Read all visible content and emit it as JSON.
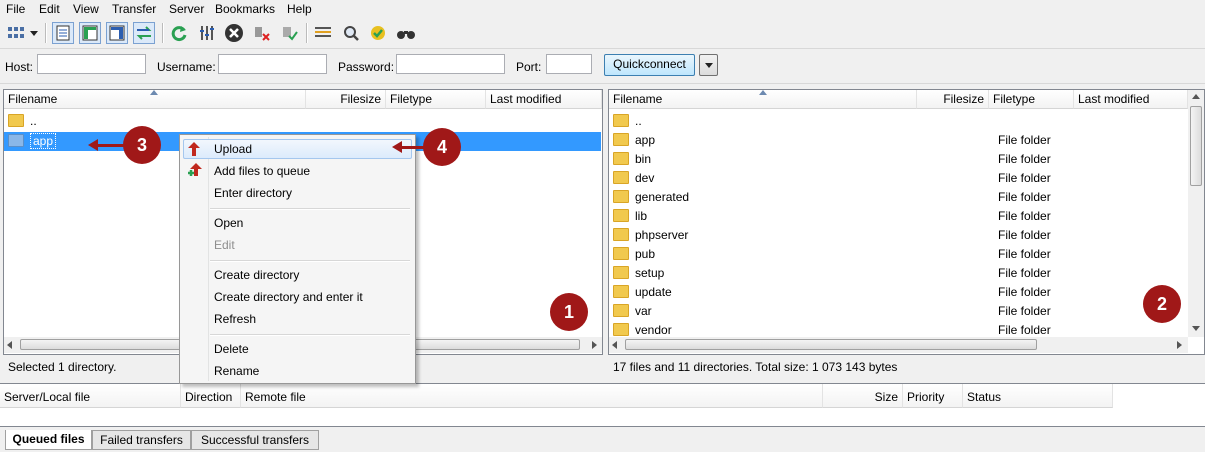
{
  "menubar": [
    "File",
    "Edit",
    "View",
    "Transfer",
    "Server",
    "Bookmarks",
    "Help"
  ],
  "toolbar": {
    "icons": [
      "site-manager-icon",
      "dropdown-arrow-icon",
      "toggle-log-icon",
      "toggle-local-tree-icon",
      "toggle-remote-tree-icon",
      "toggle-queue-icon",
      "refresh-icon",
      "process-queue-icon",
      "cancel-icon",
      "disconnect-icon",
      "reconnect-icon",
      "directory-filter-icon",
      "search-icon",
      "compare-icon",
      "find-files-icon"
    ]
  },
  "quickconnect": {
    "host_label": "Host:",
    "host_value": "",
    "username_label": "Username:",
    "username_value": "",
    "password_label": "Password:",
    "password_value": "",
    "port_label": "Port:",
    "port_value": "",
    "button": "Quickconnect"
  },
  "local": {
    "columns": [
      "Filename",
      "Filesize",
      "Filetype",
      "Last modified"
    ],
    "rows": [
      {
        "name": ".."
      },
      {
        "name": "app"
      }
    ],
    "status": "Selected 1 directory."
  },
  "remote": {
    "columns": [
      "Filename",
      "Filesize",
      "Filetype",
      "Last modified"
    ],
    "rows": [
      {
        "name": "..",
        "type": ""
      },
      {
        "name": "app",
        "type": "File folder"
      },
      {
        "name": "bin",
        "type": "File folder"
      },
      {
        "name": "dev",
        "type": "File folder"
      },
      {
        "name": "generated",
        "type": "File folder"
      },
      {
        "name": "lib",
        "type": "File folder"
      },
      {
        "name": "phpserver",
        "type": "File folder"
      },
      {
        "name": "pub",
        "type": "File folder"
      },
      {
        "name": "setup",
        "type": "File folder"
      },
      {
        "name": "update",
        "type": "File folder"
      },
      {
        "name": "var",
        "type": "File folder"
      },
      {
        "name": "vendor",
        "type": "File folder"
      }
    ],
    "status": "17 files and 11 directories. Total size: 1 073 143 bytes"
  },
  "context_menu": {
    "items": [
      "Upload",
      "Add files to queue",
      "Enter directory",
      "Open",
      "Edit",
      "Create directory",
      "Create directory and enter it",
      "Refresh",
      "Delete",
      "Rename"
    ],
    "disabled": [
      "Edit"
    ]
  },
  "queue": {
    "columns": [
      "Server/Local file",
      "Direction",
      "Remote file",
      "Size",
      "Priority",
      "Status"
    ],
    "tabs": [
      "Queued files",
      "Failed transfers",
      "Successful transfers"
    ]
  },
  "annotations": [
    "1",
    "2",
    "3",
    "4"
  ],
  "colors": {
    "accent": "#a01818",
    "selection": "#3399ff",
    "folder": "#f1c94e"
  }
}
